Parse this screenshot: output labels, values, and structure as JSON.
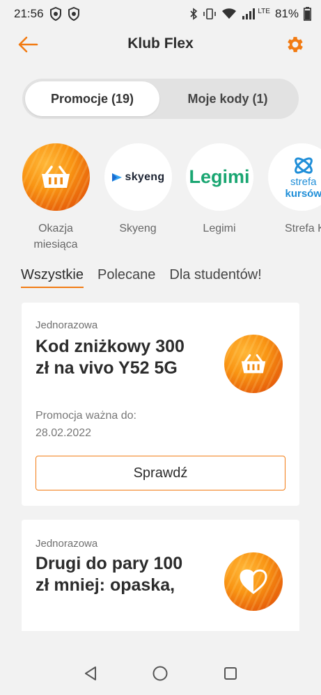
{
  "status": {
    "time": "21:56",
    "battery": "81%",
    "network": "LTE"
  },
  "header": {
    "title": "Klub Flex"
  },
  "tabs": [
    {
      "label": "Promocje (19)"
    },
    {
      "label": "Moje kody (1)"
    }
  ],
  "brands": [
    {
      "label": "Okazja miesiąca",
      "icon": "basket-icon"
    },
    {
      "label": "Skyeng",
      "logo_text": "skyeng"
    },
    {
      "label": "Legimi",
      "logo_text": "Legimi"
    },
    {
      "label": "Strefa Kursów",
      "logo_text_1": "strefa",
      "logo_text_2": "kursów"
    }
  ],
  "categories": [
    {
      "label": "Wszystkie"
    },
    {
      "label": "Polecane"
    },
    {
      "label": "Dla studentów!"
    }
  ],
  "offers": [
    {
      "type": "Jednorazowa",
      "title": "Kod zniżkowy 300 zł na vivo Y52 5G",
      "valid_label": "Promocja ważna do:",
      "valid_date": "28.02.2022",
      "button": "Sprawdź",
      "icon": "basket-icon"
    },
    {
      "type": "Jednorazowa",
      "title": "Drugi do pary 100 zł mniej: opaska, ",
      "icon": "heart-icon"
    }
  ],
  "colors": {
    "accent": "#f27b12",
    "legimi": "#1aa672",
    "skyeng_blue": "#2fa0f0",
    "strefa_blue": "#1f8ed8"
  }
}
